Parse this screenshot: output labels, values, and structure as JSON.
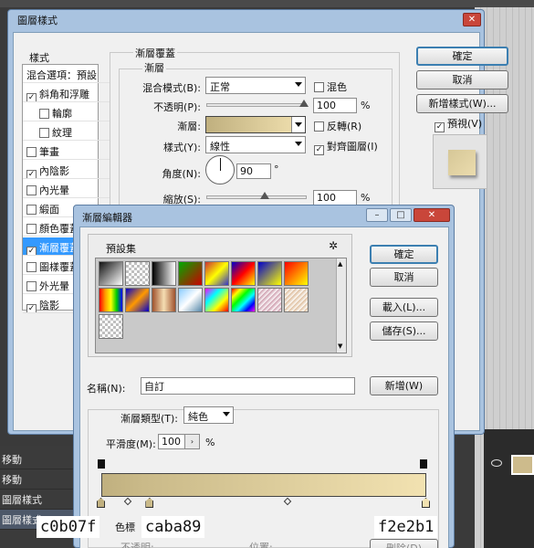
{
  "layer_style": {
    "title": "圖層樣式",
    "styles_header": "樣式",
    "styles": [
      {
        "label": "混合選項：預設",
        "checkbox": false,
        "checked": false,
        "indent": false,
        "selected": false
      },
      {
        "label": "斜角和浮雕",
        "checkbox": true,
        "checked": true,
        "indent": false,
        "selected": false
      },
      {
        "label": "輪廓",
        "checkbox": true,
        "checked": false,
        "indent": true,
        "selected": false
      },
      {
        "label": "紋理",
        "checkbox": true,
        "checked": false,
        "indent": true,
        "selected": false
      },
      {
        "label": "筆畫",
        "checkbox": true,
        "checked": false,
        "indent": false,
        "selected": false
      },
      {
        "label": "內陰影",
        "checkbox": true,
        "checked": true,
        "indent": false,
        "selected": false
      },
      {
        "label": "內光暈",
        "checkbox": true,
        "checked": false,
        "indent": false,
        "selected": false
      },
      {
        "label": "緞面",
        "checkbox": true,
        "checked": false,
        "indent": false,
        "selected": false
      },
      {
        "label": "顏色覆蓋",
        "checkbox": true,
        "checked": false,
        "indent": false,
        "selected": false
      },
      {
        "label": "漸層覆蓋",
        "checkbox": true,
        "checked": true,
        "indent": false,
        "selected": true
      },
      {
        "label": "圖樣覆蓋",
        "checkbox": true,
        "checked": false,
        "indent": false,
        "selected": false
      },
      {
        "label": "外光暈",
        "checkbox": true,
        "checked": false,
        "indent": false,
        "selected": false
      },
      {
        "label": "陰影",
        "checkbox": true,
        "checked": true,
        "indent": false,
        "selected": false
      }
    ],
    "group_title": "漸層覆蓋",
    "sub_title": "漸層",
    "blend_mode_label": "混合模式(B):",
    "blend_mode_value": "正常",
    "dither_label": "混色",
    "opacity_label": "不透明(P):",
    "opacity_value": "100",
    "opacity_pct": 100,
    "opacity_unit": "%",
    "gradient_label": "漸層:",
    "reverse_label": "反轉(R)",
    "style_label": "樣式(Y):",
    "style_value": "線性",
    "align_label": "對齊圖層(I)",
    "angle_label": "角度(N):",
    "angle_value": "90",
    "angle_unit": "°",
    "scale_label": "縮放(S):",
    "scale_value": "100",
    "scale_unit": "%",
    "ok": "確定",
    "cancel": "取消",
    "new_style": "新增樣式(W)...",
    "preview_label": "預視(V)"
  },
  "gradient_editor": {
    "title": "漸層編輯器",
    "presets_label": "預設集",
    "ok": "確定",
    "cancel": "取消",
    "load": "載入(L)...",
    "save": "儲存(S)...",
    "name_label": "名稱(N):",
    "name_value": "自訂",
    "new_button": "新增(W)",
    "gradient_type_label": "漸層類型(T):",
    "gradient_type_value": "純色",
    "smoothness_label": "平滑度(M):",
    "smoothness_value": "100",
    "smoothness_unit": "%",
    "stops_group_label": "色標",
    "opacity_stop_label": "不透明:",
    "location_label": "位置:",
    "delete_button": "刪除(D)",
    "color_stops": [
      {
        "hex": "c0b07f",
        "location_pct": 0
      },
      {
        "hex": "caba89",
        "location_pct": 15
      },
      {
        "hex": "f2e2b1",
        "location_pct": 100
      }
    ]
  },
  "background": {
    "actions": [
      "移動",
      "移動",
      "圖層樣式",
      "圖層樣式"
    ]
  },
  "colors": {
    "stop_1": "#c0b07f",
    "stop_2": "#caba89",
    "stop_3": "#f2e2b1",
    "selection": "#3399ff",
    "window_frame": "#a9c3e0"
  }
}
